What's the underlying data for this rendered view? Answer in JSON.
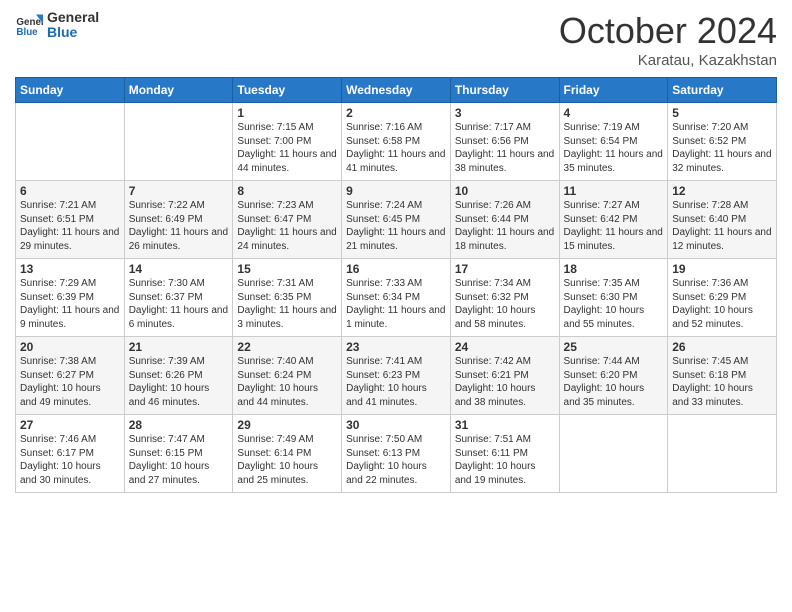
{
  "header": {
    "logo_line1": "General",
    "logo_line2": "Blue",
    "month": "October 2024",
    "location": "Karatau, Kazakhstan"
  },
  "weekdays": [
    "Sunday",
    "Monday",
    "Tuesday",
    "Wednesday",
    "Thursday",
    "Friday",
    "Saturday"
  ],
  "weeks": [
    [
      {
        "day": "",
        "info": ""
      },
      {
        "day": "",
        "info": ""
      },
      {
        "day": "1",
        "info": "Sunrise: 7:15 AM\nSunset: 7:00 PM\nDaylight: 11 hours and 44 minutes."
      },
      {
        "day": "2",
        "info": "Sunrise: 7:16 AM\nSunset: 6:58 PM\nDaylight: 11 hours and 41 minutes."
      },
      {
        "day": "3",
        "info": "Sunrise: 7:17 AM\nSunset: 6:56 PM\nDaylight: 11 hours and 38 minutes."
      },
      {
        "day": "4",
        "info": "Sunrise: 7:19 AM\nSunset: 6:54 PM\nDaylight: 11 hours and 35 minutes."
      },
      {
        "day": "5",
        "info": "Sunrise: 7:20 AM\nSunset: 6:52 PM\nDaylight: 11 hours and 32 minutes."
      }
    ],
    [
      {
        "day": "6",
        "info": "Sunrise: 7:21 AM\nSunset: 6:51 PM\nDaylight: 11 hours and 29 minutes."
      },
      {
        "day": "7",
        "info": "Sunrise: 7:22 AM\nSunset: 6:49 PM\nDaylight: 11 hours and 26 minutes."
      },
      {
        "day": "8",
        "info": "Sunrise: 7:23 AM\nSunset: 6:47 PM\nDaylight: 11 hours and 24 minutes."
      },
      {
        "day": "9",
        "info": "Sunrise: 7:24 AM\nSunset: 6:45 PM\nDaylight: 11 hours and 21 minutes."
      },
      {
        "day": "10",
        "info": "Sunrise: 7:26 AM\nSunset: 6:44 PM\nDaylight: 11 hours and 18 minutes."
      },
      {
        "day": "11",
        "info": "Sunrise: 7:27 AM\nSunset: 6:42 PM\nDaylight: 11 hours and 15 minutes."
      },
      {
        "day": "12",
        "info": "Sunrise: 7:28 AM\nSunset: 6:40 PM\nDaylight: 11 hours and 12 minutes."
      }
    ],
    [
      {
        "day": "13",
        "info": "Sunrise: 7:29 AM\nSunset: 6:39 PM\nDaylight: 11 hours and 9 minutes."
      },
      {
        "day": "14",
        "info": "Sunrise: 7:30 AM\nSunset: 6:37 PM\nDaylight: 11 hours and 6 minutes."
      },
      {
        "day": "15",
        "info": "Sunrise: 7:31 AM\nSunset: 6:35 PM\nDaylight: 11 hours and 3 minutes."
      },
      {
        "day": "16",
        "info": "Sunrise: 7:33 AM\nSunset: 6:34 PM\nDaylight: 11 hours and 1 minute."
      },
      {
        "day": "17",
        "info": "Sunrise: 7:34 AM\nSunset: 6:32 PM\nDaylight: 10 hours and 58 minutes."
      },
      {
        "day": "18",
        "info": "Sunrise: 7:35 AM\nSunset: 6:30 PM\nDaylight: 10 hours and 55 minutes."
      },
      {
        "day": "19",
        "info": "Sunrise: 7:36 AM\nSunset: 6:29 PM\nDaylight: 10 hours and 52 minutes."
      }
    ],
    [
      {
        "day": "20",
        "info": "Sunrise: 7:38 AM\nSunset: 6:27 PM\nDaylight: 10 hours and 49 minutes."
      },
      {
        "day": "21",
        "info": "Sunrise: 7:39 AM\nSunset: 6:26 PM\nDaylight: 10 hours and 46 minutes."
      },
      {
        "day": "22",
        "info": "Sunrise: 7:40 AM\nSunset: 6:24 PM\nDaylight: 10 hours and 44 minutes."
      },
      {
        "day": "23",
        "info": "Sunrise: 7:41 AM\nSunset: 6:23 PM\nDaylight: 10 hours and 41 minutes."
      },
      {
        "day": "24",
        "info": "Sunrise: 7:42 AM\nSunset: 6:21 PM\nDaylight: 10 hours and 38 minutes."
      },
      {
        "day": "25",
        "info": "Sunrise: 7:44 AM\nSunset: 6:20 PM\nDaylight: 10 hours and 35 minutes."
      },
      {
        "day": "26",
        "info": "Sunrise: 7:45 AM\nSunset: 6:18 PM\nDaylight: 10 hours and 33 minutes."
      }
    ],
    [
      {
        "day": "27",
        "info": "Sunrise: 7:46 AM\nSunset: 6:17 PM\nDaylight: 10 hours and 30 minutes."
      },
      {
        "day": "28",
        "info": "Sunrise: 7:47 AM\nSunset: 6:15 PM\nDaylight: 10 hours and 27 minutes."
      },
      {
        "day": "29",
        "info": "Sunrise: 7:49 AM\nSunset: 6:14 PM\nDaylight: 10 hours and 25 minutes."
      },
      {
        "day": "30",
        "info": "Sunrise: 7:50 AM\nSunset: 6:13 PM\nDaylight: 10 hours and 22 minutes."
      },
      {
        "day": "31",
        "info": "Sunrise: 7:51 AM\nSunset: 6:11 PM\nDaylight: 10 hours and 19 minutes."
      },
      {
        "day": "",
        "info": ""
      },
      {
        "day": "",
        "info": ""
      }
    ]
  ]
}
